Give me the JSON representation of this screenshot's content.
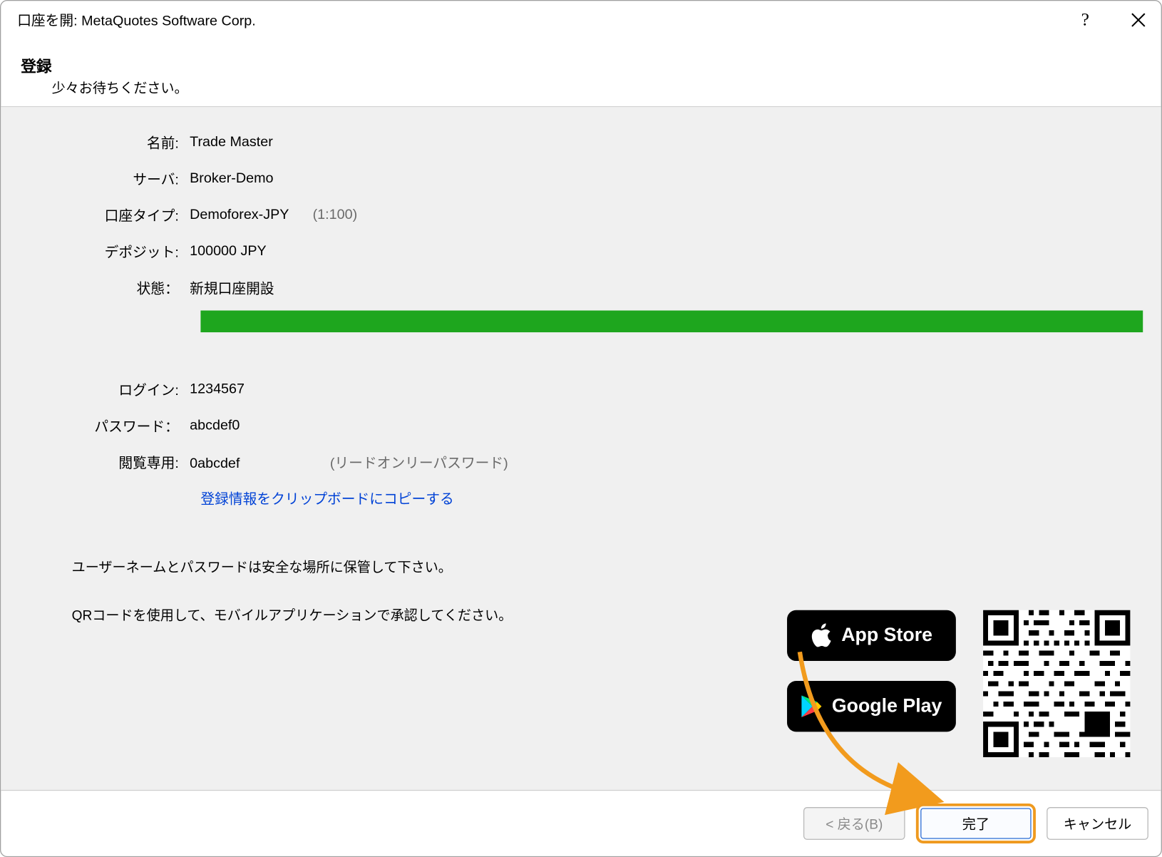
{
  "titlebar": {
    "title": "口座を開: MetaQuotes Software Corp."
  },
  "header": {
    "title": "登録",
    "subtitle": "少々お待ちください。"
  },
  "fields": {
    "name_label": "名前:",
    "name_value": "Trade Master",
    "server_label": "サーバ:",
    "server_value": "Broker-Demo",
    "account_type_label": "口座タイプ:",
    "account_type_value": "Demoforex-JPY",
    "leverage": "(1:100)",
    "deposit_label": "デポジット:",
    "deposit_value": "100000 JPY",
    "status_label": "状態：",
    "status_value": "新規口座開設",
    "login_label": "ログイン:",
    "login_value": "1234567",
    "password_label": "パスワード：",
    "password_value": "abcdef0",
    "readonly_label": "閲覧専用:",
    "readonly_value": "0abcdef",
    "readonly_hint": "(リードオンリーパスワード)"
  },
  "copy_link": "登録情報をクリップボードにコピーする",
  "hints": {
    "line1": "ユーザーネームとパスワードは安全な場所に保管して下さい。",
    "line2": "QRコードを使用して、モバイルアプリケーションで承認してください。"
  },
  "stores": {
    "appstore": "App Store",
    "googleplay": "Google Play"
  },
  "footer": {
    "back": "< 戻る(B)",
    "complete": "完了",
    "cancel": "キャンセル"
  }
}
